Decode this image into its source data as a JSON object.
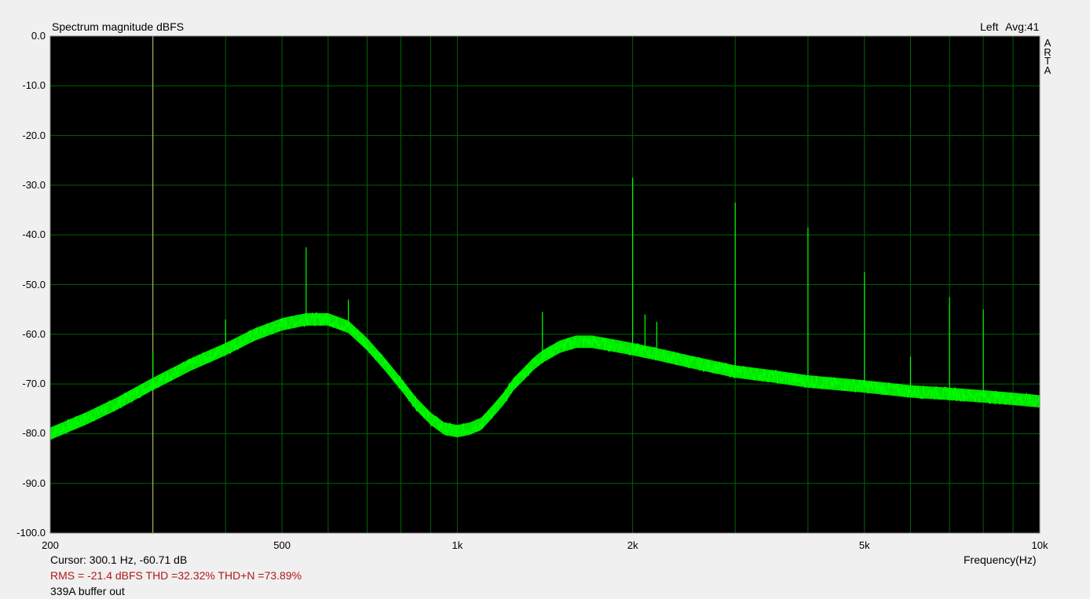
{
  "header": {
    "title": "Spectrum magnitude dBFS",
    "channel": "Left",
    "avg": "Avg:41",
    "brand_letters": [
      "A",
      "R",
      "T",
      "A"
    ]
  },
  "footer": {
    "cursor": "Cursor:   300.1 Hz, -60.71 dB",
    "measurements": "RMS =  -21.4 dBFS   THD =32.32%   THD+N =73.89%",
    "note": "339A buffer out",
    "x_axis_label": "Frequency(Hz)"
  },
  "colors": {
    "background": "#000000",
    "grid": "#006400",
    "trace": "#00ff00",
    "cursor": "#c8c864",
    "measurement_text": "#b01818"
  },
  "chart_data": {
    "type": "line",
    "title": "Spectrum magnitude dBFS",
    "xlabel": "Frequency(Hz)",
    "ylabel": "",
    "x_scale": "log",
    "xlim": [
      200,
      10000
    ],
    "ylim": [
      -100,
      0
    ],
    "grid": true,
    "x_tick_labels": [
      {
        "value": 200,
        "label": "200"
      },
      {
        "value": 500,
        "label": "500"
      },
      {
        "value": 1000,
        "label": "1k"
      },
      {
        "value": 2000,
        "label": "2k"
      },
      {
        "value": 5000,
        "label": "5k"
      },
      {
        "value": 10000,
        "label": "10k"
      }
    ],
    "y_tick_labels": [
      {
        "value": 0,
        "label": "0.0"
      },
      {
        "value": -10,
        "label": "-10.0"
      },
      {
        "value": -20,
        "label": "-20.0"
      },
      {
        "value": -30,
        "label": "-30.0"
      },
      {
        "value": -40,
        "label": "-40.0"
      },
      {
        "value": -50,
        "label": "-50.0"
      },
      {
        "value": -60,
        "label": "-60.0"
      },
      {
        "value": -70,
        "label": "-70.0"
      },
      {
        "value": -80,
        "label": "-80.0"
      },
      {
        "value": -90,
        "label": "-90.0"
      },
      {
        "value": -100,
        "label": "-100.0"
      }
    ],
    "cursor_frequency": 300.1,
    "series": [
      {
        "envelope_x": [
          200,
          230,
          260,
          300,
          350,
          400,
          450,
          500,
          550,
          600,
          650,
          700,
          750,
          800,
          850,
          900,
          950,
          1000,
          1050,
          1100,
          1150,
          1200,
          1250,
          1300,
          1350,
          1400,
          1500,
          1600,
          1700,
          1800,
          1900,
          2000,
          2200,
          2500,
          3000,
          3500,
          4000,
          5000,
          6000,
          7000,
          8000,
          9000,
          10000
        ],
        "envelope_y": [
          -80,
          -77,
          -74,
          -70,
          -66,
          -63,
          -60,
          -58,
          -57,
          -57,
          -58.5,
          -62,
          -66,
          -70,
          -74,
          -77,
          -79,
          -79.5,
          -79,
          -78,
          -75.5,
          -73,
          -70,
          -68,
          -66,
          -64.5,
          -62.5,
          -61.5,
          -61.5,
          -62,
          -62.5,
          -63,
          -64,
          -65.5,
          -67.5,
          -68.5,
          -69.5,
          -70.5,
          -71.5,
          -72,
          -72.5,
          -73,
          -73.5
        ],
        "band_width_db": 2.5
      }
    ],
    "spikes": [
      {
        "freq": 300,
        "db": -63.5
      },
      {
        "freq": 400,
        "db": -57
      },
      {
        "freq": 550,
        "db": -42.5
      },
      {
        "freq": 650,
        "db": -53
      },
      {
        "freq": 1400,
        "db": -55.5
      },
      {
        "freq": 2000,
        "db": -28.5
      },
      {
        "freq": 2100,
        "db": -56
      },
      {
        "freq": 2200,
        "db": -57.5
      },
      {
        "freq": 3000,
        "db": -33.5
      },
      {
        "freq": 4000,
        "db": -38.5
      },
      {
        "freq": 5000,
        "db": -47.5
      },
      {
        "freq": 6000,
        "db": -64.5
      },
      {
        "freq": 7000,
        "db": -52.5
      },
      {
        "freq": 8000,
        "db": -55
      }
    ]
  }
}
